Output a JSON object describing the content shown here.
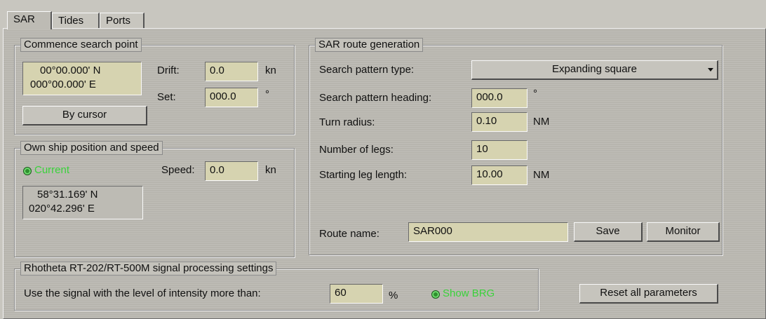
{
  "tabs": [
    "SAR",
    "Tides",
    "Ports"
  ],
  "commence": {
    "title": "Commence search point",
    "position": [
      "00°00.000' N",
      "000°00.000' E"
    ],
    "drift_label": "Drift:",
    "drift_value": "0.0",
    "drift_unit": "kn",
    "set_label": "Set:",
    "set_value": "000.0",
    "set_unit": "°",
    "by_cursor_label": "By cursor"
  },
  "own_ship": {
    "title": "Own ship position and speed",
    "current_label": "Current",
    "speed_label": "Speed:",
    "speed_value": "0.0",
    "speed_unit": "kn",
    "position": [
      "58°31.169' N",
      "020°42.296' E"
    ]
  },
  "route": {
    "title": "SAR route generation",
    "pattern_type_label": "Search pattern type:",
    "pattern_type_value": "Expanding square",
    "heading_label": "Search pattern heading:",
    "heading_value": "000.0",
    "heading_unit": "°",
    "turn_radius_label": "Turn radius:",
    "turn_radius_value": "0.10",
    "turn_radius_unit": "NM",
    "legs_label": "Number of legs:",
    "legs_value": "10",
    "leg_length_label": "Starting leg length:",
    "leg_length_value": "10.00",
    "leg_length_unit": "NM",
    "route_name_label": "Route name:",
    "route_name_value": "SAR000",
    "save_label": "Save",
    "monitor_label": "Monitor"
  },
  "rhotheta": {
    "title": "Rhotheta RT-202/RT-500M signal processing settings",
    "intensity_label": "Use the signal with the level of intensity more than:",
    "intensity_value": "60",
    "intensity_unit": "%",
    "show_brg_label": "Show BRG"
  },
  "reset_label": "Reset all parameters",
  "colors": {
    "field_bg": "#d6d3b0",
    "panel_bg": "#bdbbb4",
    "indicator_green": "#39d23a"
  }
}
